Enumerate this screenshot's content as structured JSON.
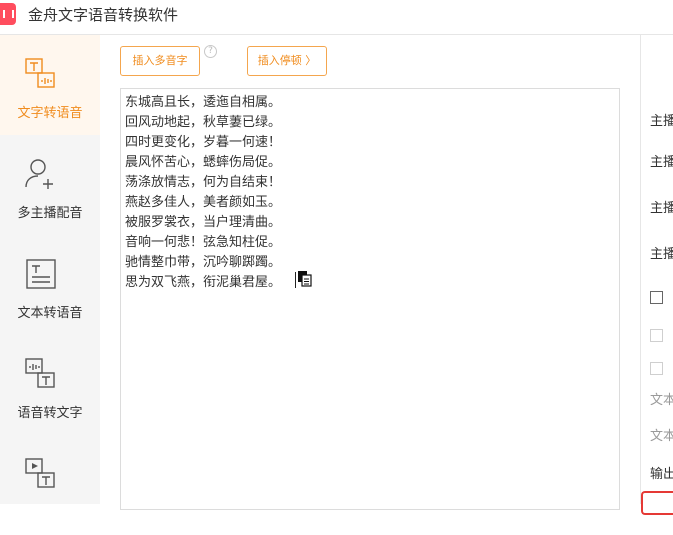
{
  "app": {
    "title": "金舟文字语音转换软件"
  },
  "sidebar": {
    "items": [
      {
        "label": "文字转语音",
        "icon": "text-to-speech-icon",
        "active": true
      },
      {
        "label": "多主播配音",
        "icon": "user-add-icon",
        "active": false
      },
      {
        "label": "文本转语音",
        "icon": "document-text-icon",
        "active": false
      },
      {
        "label": "语音转文字",
        "icon": "speech-to-text-icon",
        "active": false
      },
      {
        "label": "",
        "icon": "video-to-text-icon",
        "active": false
      }
    ]
  },
  "toolbar": {
    "insert_polyphone": "插入多音字",
    "insert_pause": "插入停顿 〉"
  },
  "editor": {
    "lines": [
      "东城高且长，逶迤自相属。",
      "回风动地起，秋草萋已绿。",
      "四时更变化，岁暮一何速！",
      "晨风怀苦心，蟋蟀伤局促。",
      "荡涤放情志，何为自结束！",
      "燕赵多佳人，美者颜如玉。",
      "被服罗裳衣，当户理清曲。",
      "音响一何悲！弦急知柱促。",
      "驰情整巾带，沉吟聊踯躅。",
      "思为双飞燕，衔泥巢君屋。"
    ]
  },
  "right_panel": {
    "labels": [
      "主播",
      "主播",
      "主播",
      "主播",
      "文本",
      "文本",
      "输出"
    ]
  },
  "colors": {
    "accent": "#f08c1e",
    "brand": "#ff4d5e",
    "alert": "#e53935"
  }
}
